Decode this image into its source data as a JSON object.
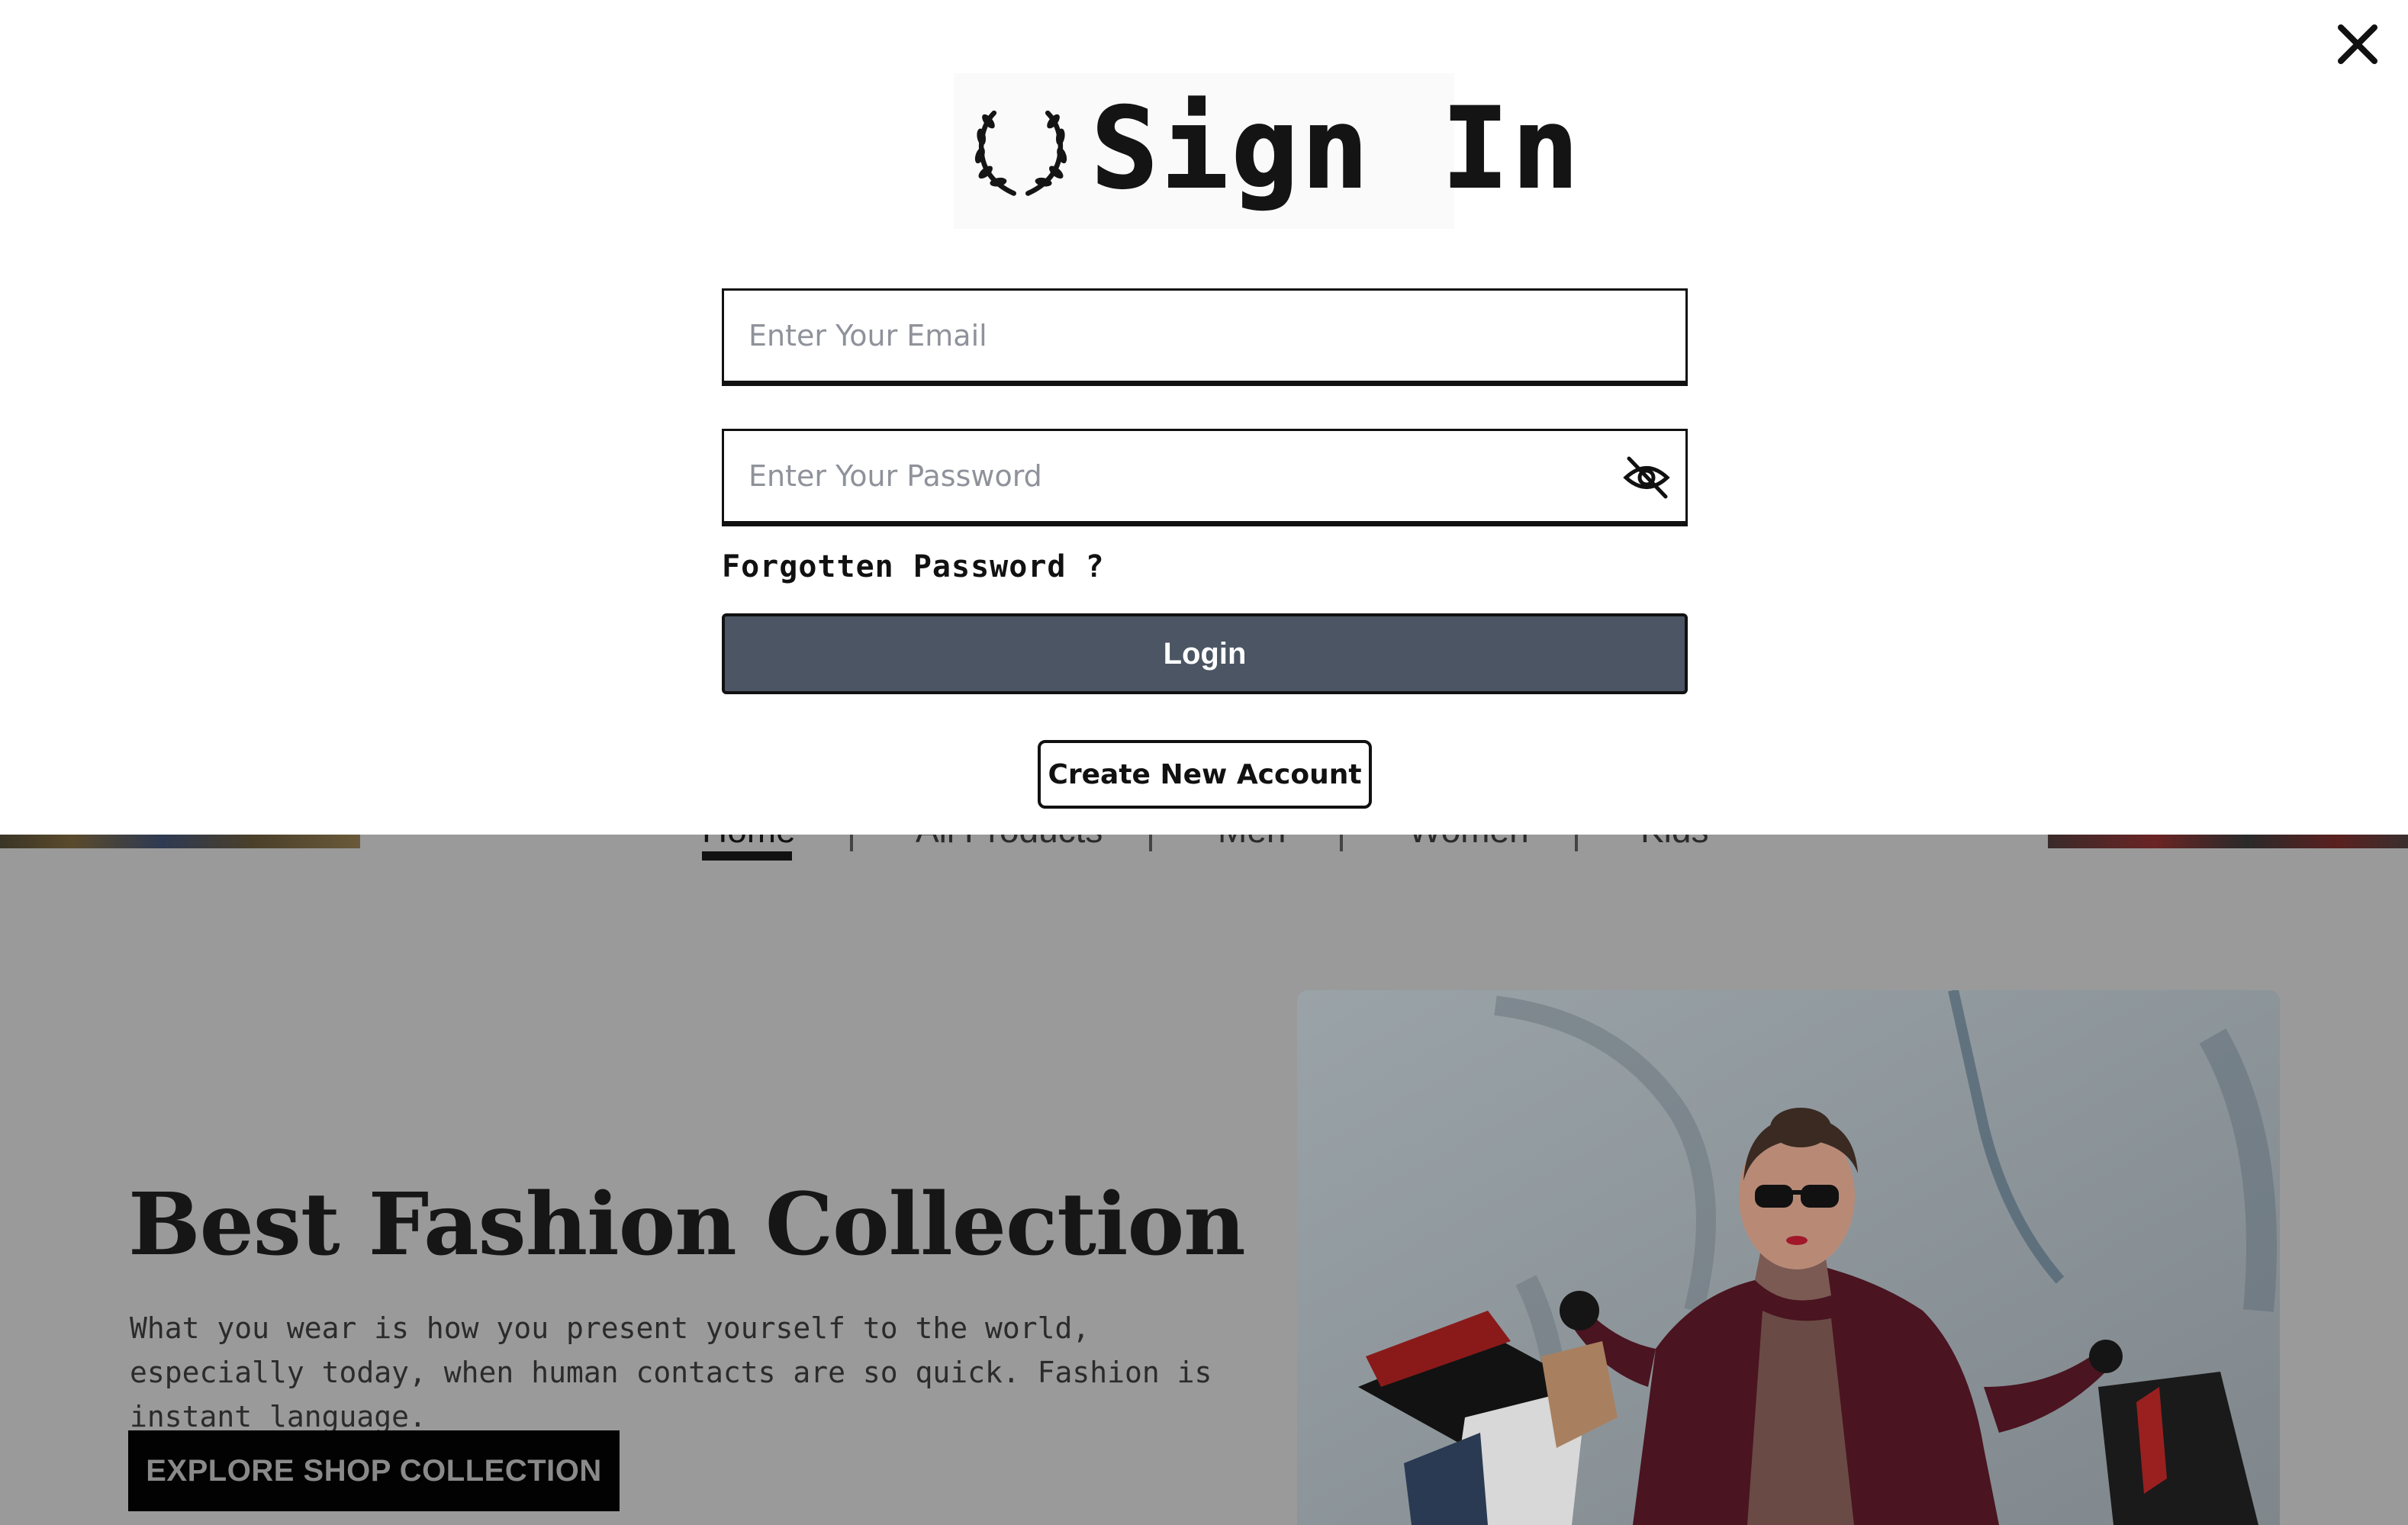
{
  "modal": {
    "title": "Sign In",
    "email_placeholder": "Enter Your Email",
    "password_placeholder": "Enter Your Password",
    "forgot_label": "Forgotten Password ?",
    "login_label": "Login",
    "create_account_label": "Create New Account",
    "close_icon": "close-icon",
    "password_toggle_icon": "eye-off-icon",
    "logo_icon": "laurel-wreath-icon"
  },
  "nav": {
    "items": [
      {
        "label": "Home",
        "active": true
      },
      {
        "label": "All Products"
      },
      {
        "label": "Men"
      },
      {
        "label": "Women"
      },
      {
        "label": "Kids"
      }
    ]
  },
  "hero": {
    "title": "Best Fashion Collection",
    "text": "What you wear is how you present yourself to the world, especially today, when human contacts are so quick. Fashion is instant language.",
    "button_label": "EXPLORE SHOP COLLECTION"
  },
  "colors": {
    "overlay": "#9a9a9a",
    "login_button": "#4b5563",
    "text_dark": "#111111"
  }
}
